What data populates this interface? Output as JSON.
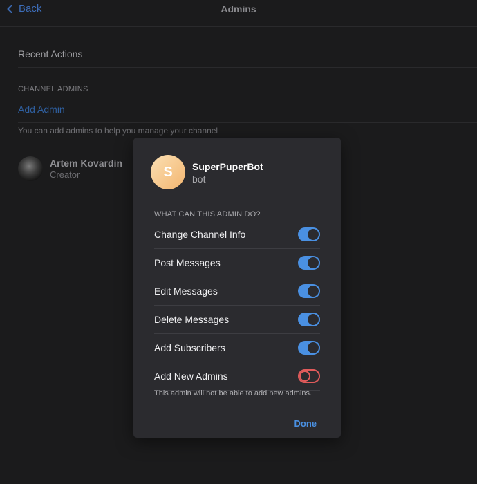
{
  "header": {
    "back_label": "Back",
    "title": "Admins"
  },
  "list": {
    "recent_actions": "Recent Actions",
    "section_title": "CHANNEL ADMINS",
    "add_admin": "Add Admin",
    "footer_note": "You can add admins to help you manage your channel",
    "admins": [
      {
        "name": "Artem Kovardin",
        "role": "Creator"
      }
    ]
  },
  "dialog": {
    "avatar_letter": "S",
    "bot_name": "SuperPuperBot",
    "bot_subtitle": "bot",
    "section_title": "WHAT CAN THIS ADMIN DO?",
    "permissions": [
      {
        "label": "Change Channel Info",
        "enabled": true
      },
      {
        "label": "Post Messages",
        "enabled": true
      },
      {
        "label": "Edit Messages",
        "enabled": true
      },
      {
        "label": "Delete Messages",
        "enabled": true
      },
      {
        "label": "Add Subscribers",
        "enabled": true
      },
      {
        "label": "Add New Admins",
        "enabled": false
      }
    ],
    "note": "This admin will not be able to add new admins.",
    "done_label": "Done"
  },
  "colors": {
    "accent": "#4a90e2",
    "toggle_off": "#e25b5b",
    "avatar_gradient": [
      "#fbe0b4",
      "#f3b56f"
    ]
  },
  "icons": {
    "back": "chevron-left-icon"
  }
}
